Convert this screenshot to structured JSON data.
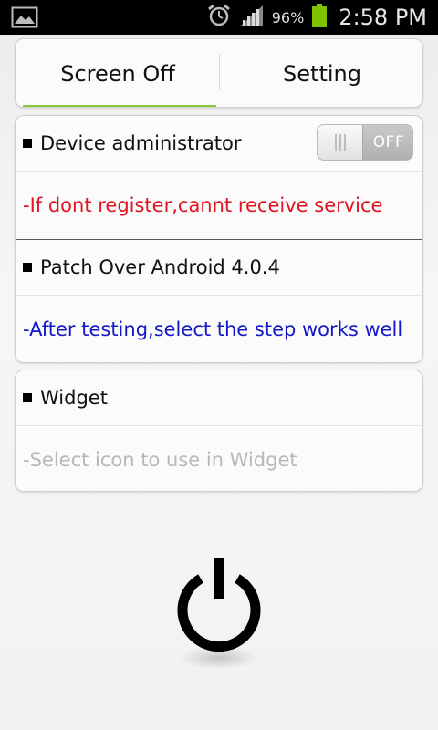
{
  "status_bar": {
    "battery_percent": "96%",
    "time": "2:58 PM",
    "icons": [
      "gallery-icon",
      "alarm-icon",
      "signal-icon",
      "battery-icon"
    ],
    "battery_color": "#7cc300"
  },
  "tabs": [
    {
      "label": "Screen Off",
      "selected": true
    },
    {
      "label": "Setting",
      "selected": false
    }
  ],
  "accent_color": "#8cc63f",
  "settings": {
    "device_admin": {
      "title": "Device administrator",
      "toggle_state": "OFF",
      "description": "-If dont register,cannt receive service",
      "description_color": "#e0141e"
    },
    "patch": {
      "title": "Patch Over Android 4.0.4",
      "description": "-After testing,select the step works well",
      "description_color": "#1318c8"
    },
    "widget": {
      "title": "Widget",
      "description": "-Select icon to use in Widget",
      "description_color": "#b8b8b8"
    }
  },
  "power_button": {
    "icon": "power-icon"
  }
}
